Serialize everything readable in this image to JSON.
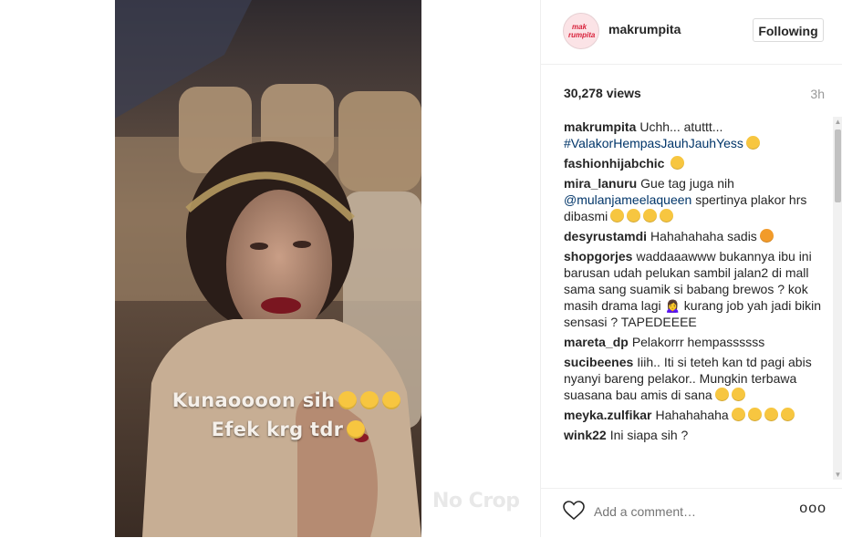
{
  "video": {
    "overlay_line1": "Kunaoooon sih",
    "overlay_line2": "Efek krg tdr",
    "watermark": "No Crop"
  },
  "post": {
    "avatar_text_top": "mak",
    "avatar_text_bottom": "rumpita",
    "username": "makrumpita",
    "follow_label": "Following",
    "views": "30,278 views",
    "time": "3h"
  },
  "comments": [
    {
      "user": "makrumpita",
      "text": "Uchh... atuttt...",
      "link": "#ValakorHempasJauhJauhYess",
      "emoji_count": 1
    },
    {
      "user": "fashionhijabchic",
      "text": "",
      "emoji_count": 1
    },
    {
      "user": "mira_lanuru",
      "text": "Gue tag juga nih",
      "link": "@mulanjameelaqueen",
      "text2": "spertinya plakor hrs dibasmi",
      "emoji_count": 4
    },
    {
      "user": "desyrustamdi",
      "text": "Hahahahaha sadis",
      "emoji_count": 1
    },
    {
      "user": "shopgorjes",
      "text": "waddaaawww bukannya ibu ini barusan udah pelukan sambil jalan2 di mall sama sang suamik si babang brewos ? kok masih drama lagi 🙍‍♀️ kurang job yah jadi bikin sensasi ? TAPEDEEEE",
      "emoji_count": 0
    },
    {
      "user": "mareta_dp",
      "text": "Pelakorrr hempassssss",
      "emoji_count": 0
    },
    {
      "user": "sucibeenes",
      "text": "Iiih.. Iti si teteh kan td pagi abis nyanyi bareng pelakor.. Mungkin terbawa suasana bau amis di sana",
      "emoji_count": 2
    },
    {
      "user": "meyka.zulfikar",
      "text": "Hahahahaha",
      "emoji_count": 4
    },
    {
      "user": "wink22",
      "text": "Ini siapa sih ?",
      "emoji_count": 0
    }
  ],
  "footer": {
    "add_comment_placeholder": "Add a comment…",
    "more_label": "ooo"
  },
  "icons": {
    "heart": "heart-icon",
    "more": "more-options-icon"
  },
  "colors": {
    "link": "#003569",
    "button_border": "#dbdbdb",
    "muted": "#999999"
  }
}
